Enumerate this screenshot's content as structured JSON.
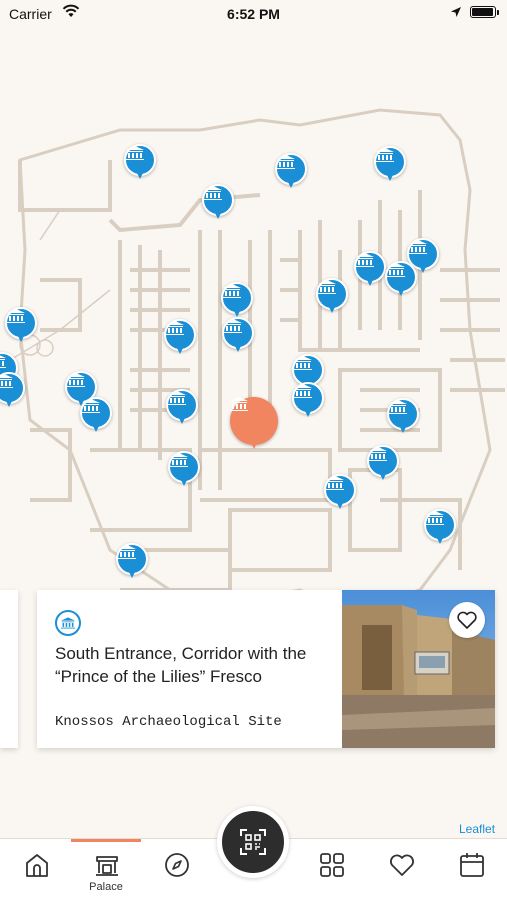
{
  "status_bar": {
    "carrier": "Carrier",
    "time": "6:52 PM"
  },
  "map": {
    "attribution": "Leaflet",
    "marker_icon": "museum-icon",
    "selected_marker_color": "#f08560",
    "marker_color": "#1a8fd6"
  },
  "card": {
    "category_icon": "museum-icon",
    "title": "South Entrance, Corridor with the “Prince of the Lilies” Fresco",
    "subtitle": "Knossos Archaeological Site",
    "favorite_icon": "heart-icon"
  },
  "tabs": [
    {
      "name": "home",
      "icon": "home-icon",
      "label": ""
    },
    {
      "name": "palace",
      "icon": "palace-icon",
      "label": "Palace",
      "active": true
    },
    {
      "name": "explore",
      "icon": "compass-icon",
      "label": ""
    },
    {
      "name": "scan",
      "icon": "qr-scan-icon",
      "label": ""
    },
    {
      "name": "categories",
      "icon": "grid-icon",
      "label": ""
    },
    {
      "name": "favorites",
      "icon": "heart-icon",
      "label": ""
    },
    {
      "name": "calendar",
      "icon": "calendar-icon",
      "label": ""
    }
  ]
}
